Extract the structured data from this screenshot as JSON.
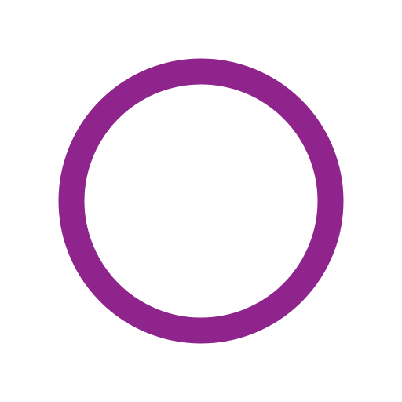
{
  "icon": {
    "name": "circle-outline-icon",
    "colors": {
      "background": "#ffffff",
      "ring": "#8e248c"
    }
  }
}
